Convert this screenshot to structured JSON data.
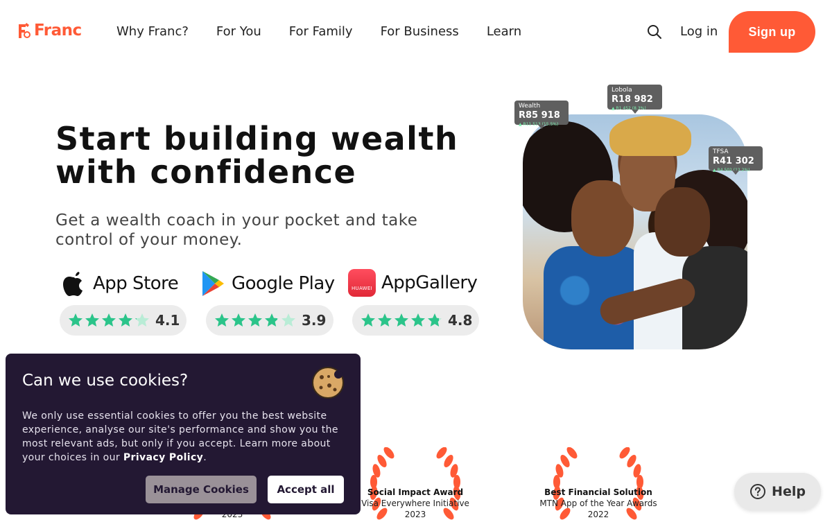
{
  "header": {
    "logo_text": "Franc",
    "nav": [
      "Why Franc?",
      "For You",
      "For Family",
      "For Business",
      "Learn"
    ],
    "login_label": "Log in",
    "signup_label": "Sign up",
    "icons": {
      "search": "search-icon",
      "logo": "franc-logo-icon"
    }
  },
  "hero": {
    "title": "Start building wealth with confidence",
    "subtitle": "Get a wealth coach in your pocket and take control of your money."
  },
  "stores": [
    {
      "name": "App Store",
      "icon": "apple-icon",
      "rating": "4.1",
      "rating_value": 4.1
    },
    {
      "name": "Google Play",
      "icon": "google-play-icon",
      "rating": "3.9",
      "rating_value": 3.9
    },
    {
      "name": "AppGallery",
      "icon": "huawei-icon",
      "badge_text": "HUAWEI",
      "rating": "4.8",
      "rating_value": 4.8
    }
  ],
  "photo_tags": {
    "wealth": {
      "label": "Wealth",
      "amount": "R85 918",
      "change": "▲ R11 513 (15.5%)"
    },
    "lobola": {
      "label": "Lobola",
      "amount": "R18 982",
      "change": "▲ R1 452 (8.3%)"
    },
    "tfsa": {
      "label": "TFSA",
      "amount": "R41 302",
      "change": "▲ R4 502 (12.2%)"
    }
  },
  "awards": [
    {
      "title": "",
      "subtitle": "",
      "year": "2023"
    },
    {
      "title": "Social Impact Award",
      "subtitle": "Visa Everywhere Initiative",
      "year": "2023"
    },
    {
      "title": "Best Financial Solution",
      "subtitle": "MTN App of the Year Awards",
      "year": "2022"
    }
  ],
  "cookie": {
    "title": "Can we use cookies?",
    "body": "We only use essential cookies to offer you the best website experience, analyse our site's performance and show you the most relevant ads, but only if you accept. Learn more about your choices in our ",
    "policy_link": "Privacy Policy",
    "body_end": ".",
    "manage_label": "Manage Cookies",
    "accept_label": "Accept all"
  },
  "help": {
    "label": "Help"
  },
  "colors": {
    "brand": "#ff5a36",
    "star": "#2bc48a",
    "cookie_bg": "#231833"
  }
}
